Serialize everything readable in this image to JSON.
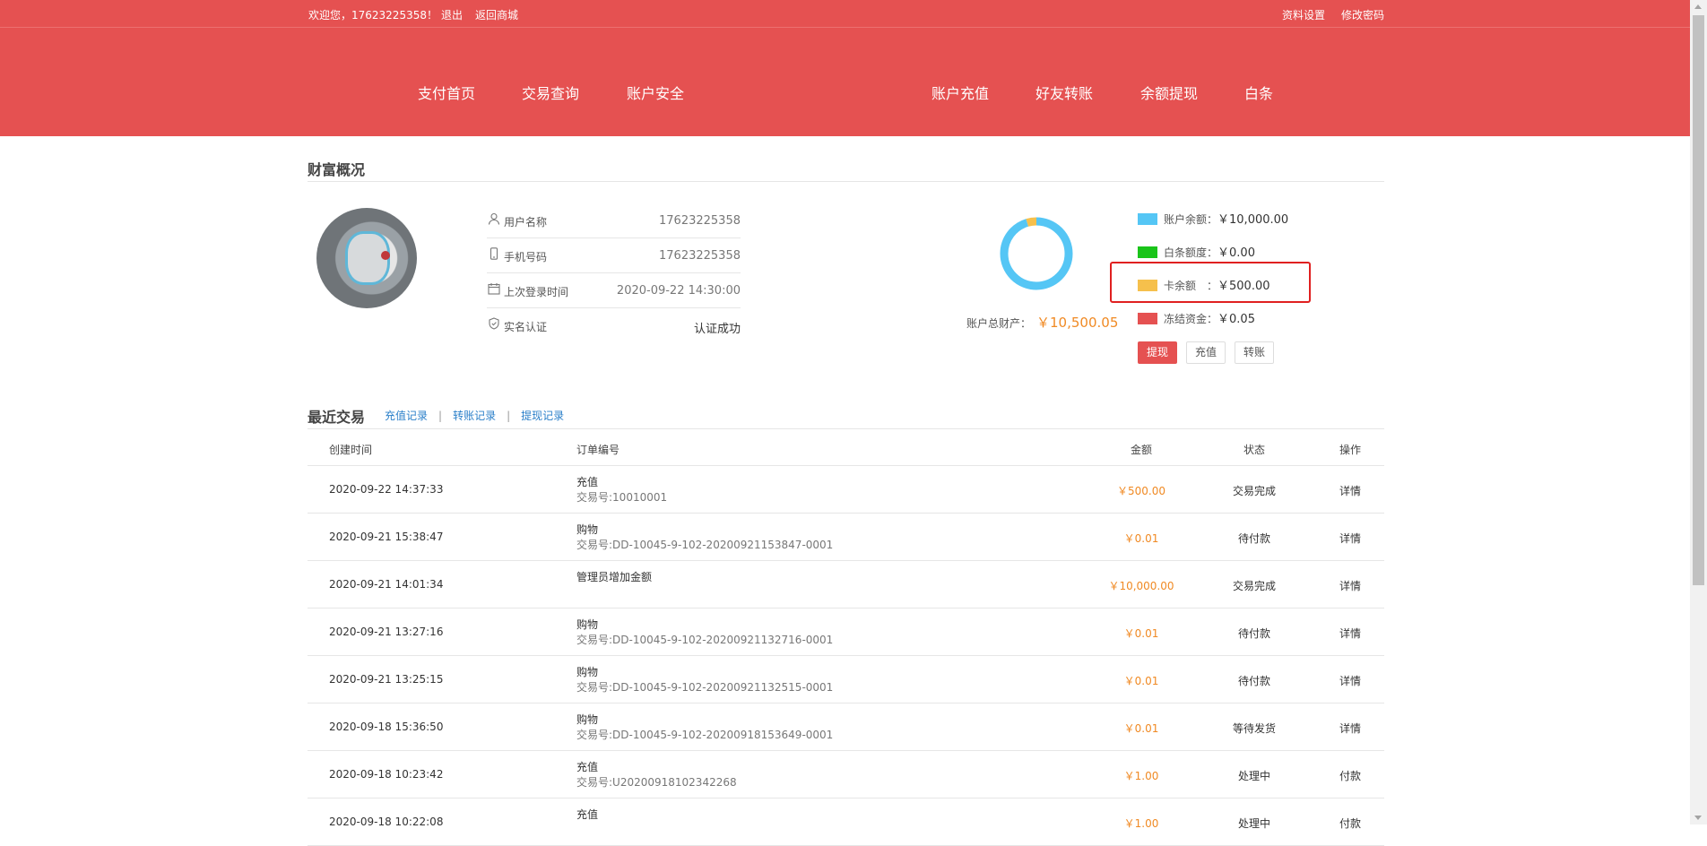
{
  "topbar": {
    "welcome": "欢迎您，17623225358！",
    "logout": "退出",
    "back_to_mall": "返回商城",
    "profile_settings": "资料设置",
    "change_password": "修改密码"
  },
  "nav": {
    "items": [
      "支付首页",
      "交易查询",
      "账户安全",
      "账户充值",
      "好友转账",
      "余额提现",
      "白条"
    ]
  },
  "wealth": {
    "title": "财富概况",
    "info": [
      {
        "icon": "user-icon",
        "label": "用户名称",
        "value": "17623225358"
      },
      {
        "icon": "phone-icon",
        "label": "手机号码",
        "value": "17623225358"
      },
      {
        "icon": "calendar-icon",
        "label": "上次登录时间",
        "value": "2020-09-22 14:30:00"
      },
      {
        "icon": "shield-icon",
        "label": "实名认证",
        "value": "认证成功"
      }
    ],
    "total_label": "账户总财产：",
    "total_value": "￥10,500.05",
    "legend": [
      {
        "name": "账户余额：",
        "value": "￥10,000.00",
        "color": "#55c6f5",
        "amount": 10000.0
      },
      {
        "name": "白条额度：",
        "value": "￥0.00",
        "color": "#1ac41a",
        "amount": 0.0
      },
      {
        "name": "卡余额　：",
        "value": "￥500.00",
        "color": "#f6c04c",
        "amount": 500.0
      },
      {
        "name": "冻结资金：",
        "value": "￥0.05",
        "color": "#e55151",
        "amount": 0.05
      }
    ],
    "buttons": {
      "withdraw": "提现",
      "recharge": "充值",
      "transfer": "转账"
    }
  },
  "recent": {
    "title": "最近交易",
    "links": [
      "充值记录",
      "转账记录",
      "提现记录"
    ],
    "columns": [
      "创建时间",
      "订单编号",
      "金额",
      "状态",
      "操作"
    ],
    "rows": [
      {
        "time": "2020-09-22 14:37:33",
        "type": "充值",
        "order": "交易号:10010001",
        "amount": "￥500.00",
        "status": "交易完成",
        "op": "详情"
      },
      {
        "time": "2020-09-21 15:38:47",
        "type": "购物",
        "order": "交易号:DD-10045-9-102-20200921153847-0001",
        "amount": "￥0.01",
        "status": "待付款",
        "op": "详情"
      },
      {
        "time": "2020-09-21 14:01:34",
        "type": "管理员增加金额",
        "order": "",
        "amount": "￥10,000.00",
        "status": "交易完成",
        "op": "详情"
      },
      {
        "time": "2020-09-21 13:27:16",
        "type": "购物",
        "order": "交易号:DD-10045-9-102-20200921132716-0001",
        "amount": "￥0.01",
        "status": "待付款",
        "op": "详情"
      },
      {
        "time": "2020-09-21 13:25:15",
        "type": "购物",
        "order": "交易号:DD-10045-9-102-20200921132515-0001",
        "amount": "￥0.01",
        "status": "待付款",
        "op": "详情"
      },
      {
        "time": "2020-09-18 15:36:50",
        "type": "购物",
        "order": "交易号:DD-10045-9-102-20200918153649-0001",
        "amount": "￥0.01",
        "status": "等待发货",
        "op": "详情"
      },
      {
        "time": "2020-09-18 10:23:42",
        "type": "充值",
        "order": "交易号:U20200918102342268",
        "amount": "￥1.00",
        "status": "处理中",
        "op": "付款"
      },
      {
        "time": "2020-09-18 10:22:08",
        "type": "充值",
        "order": "",
        "amount": "￥1.00",
        "status": "处理中",
        "op": "付款"
      }
    ]
  }
}
